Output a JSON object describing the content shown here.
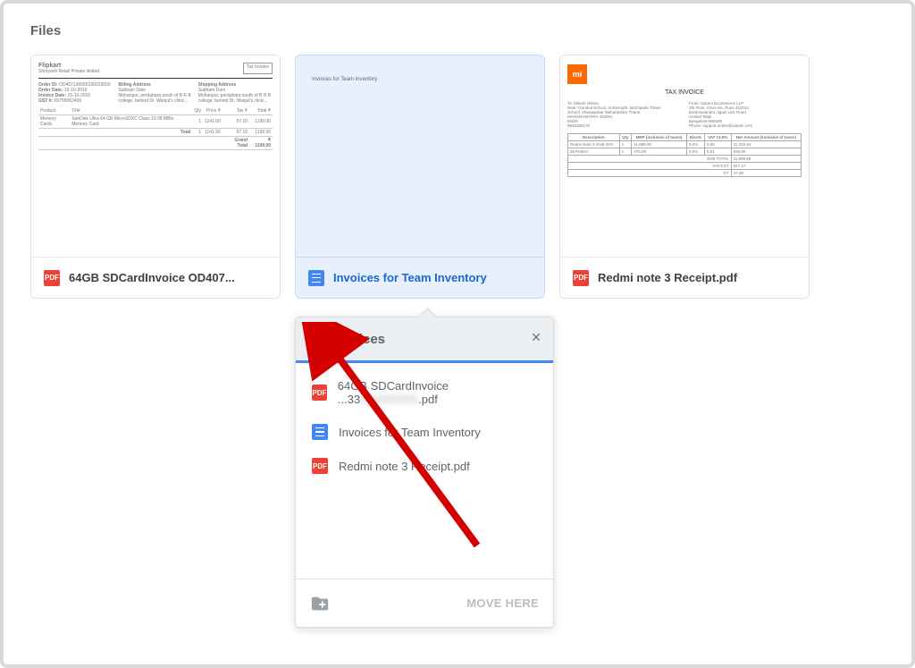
{
  "section_title": "Files",
  "cards": [
    {
      "label": "64GB SDCardInvoice OD407...",
      "type": "pdf"
    },
    {
      "label": "Invoices for Team Inventory",
      "type": "doc",
      "selected": true,
      "thumb_text": "Invoices for Team Inventory"
    },
    {
      "label": "Redmi note 3 Receipt.pdf",
      "type": "pdf"
    }
  ],
  "popover": {
    "title": "Invoices",
    "items": [
      {
        "label": "64GB SDCardInvoice ...33",
        "type": "pdf",
        "suffix": ".pdf",
        "blurred_part": "000000000"
      },
      {
        "label": "Invoices for Team Inventory",
        "type": "doc"
      },
      {
        "label": "Redmi note 3 Receipt.pdf",
        "type": "pdf"
      }
    ],
    "move_btn": "MOVE HERE"
  },
  "thumb1": {
    "brand": "Flipkart",
    "seller": "Shreyash Retail Private limited.",
    "badge": "Tax Invoice",
    "order_id_label": "Order ID:",
    "order_date_label": "Order Date:",
    "invoice_date_label": "Invoice Date:",
    "gst_label": "GST #:",
    "bill_label": "Billing Address",
    "ship_label": "Shipping Address",
    "cols": [
      "Product",
      "Title",
      "Qty",
      "Price ₹",
      "Tax ₹",
      "Total ₹"
    ],
    "row": [
      "Memory Cards",
      "SanDisk Ultra 64 GB MicroSDXC Class 10 98 MB/s Memory Card",
      "1",
      "1141.50",
      "57.10",
      "1199.00"
    ],
    "total_label": "Total",
    "total_vals": [
      "1",
      "1141.50",
      "57.10",
      "1199.00"
    ],
    "grand_label": "Grand Total",
    "grand_val": "₹ 1199.00"
  },
  "thumb3": {
    "logo": "mi",
    "title": "TAX INVOICE",
    "cols": [
      "Description",
      "Qty",
      "MRP (inclusive of taxes)",
      "Disc%",
      "VAT 13.5%",
      "Net Amount (inclusive of taxes)"
    ],
    "rows_labels": [
      "SUB TOTAL",
      "VAT/CST",
      "GT"
    ]
  }
}
